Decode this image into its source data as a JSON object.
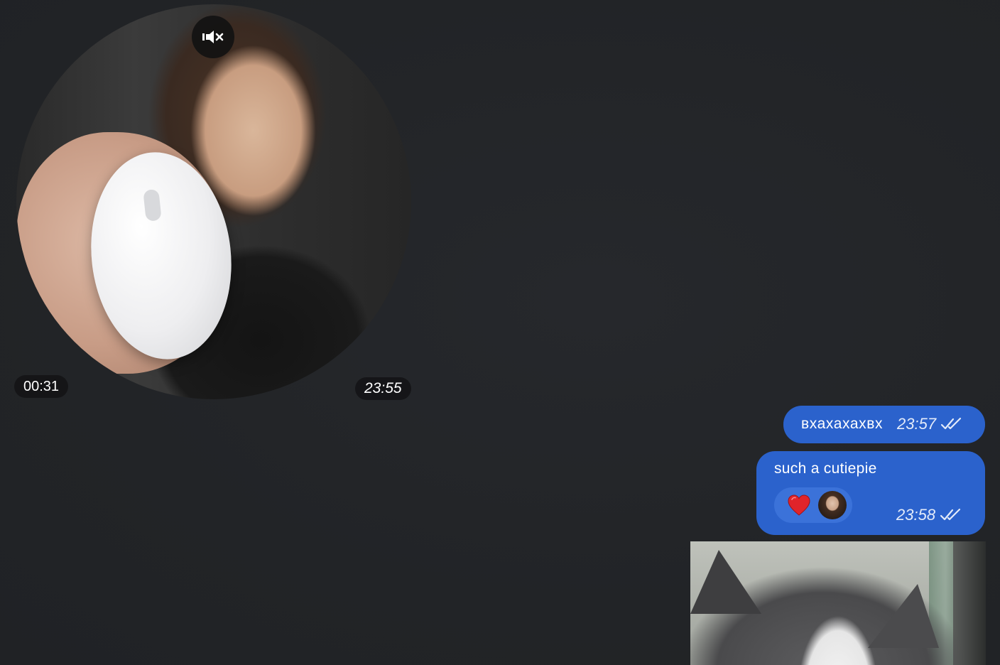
{
  "video_message": {
    "duration": "00:31",
    "time": "23:55",
    "mute_icon": "muted-speaker-icon"
  },
  "messages": [
    {
      "text": "вхахахахвх",
      "time": "23:57",
      "status_icon": "double-check-icon"
    },
    {
      "text": "such a cutiepie",
      "time": "23:58",
      "status_icon": "double-check-icon",
      "reaction": {
        "emoji": "❤️",
        "icon": "heart-icon"
      }
    }
  ],
  "colors": {
    "background": "#222427",
    "outgoing_bubble": "#2b62cc",
    "reaction_pill": "#3b72d9",
    "heart": "#e0242a"
  }
}
